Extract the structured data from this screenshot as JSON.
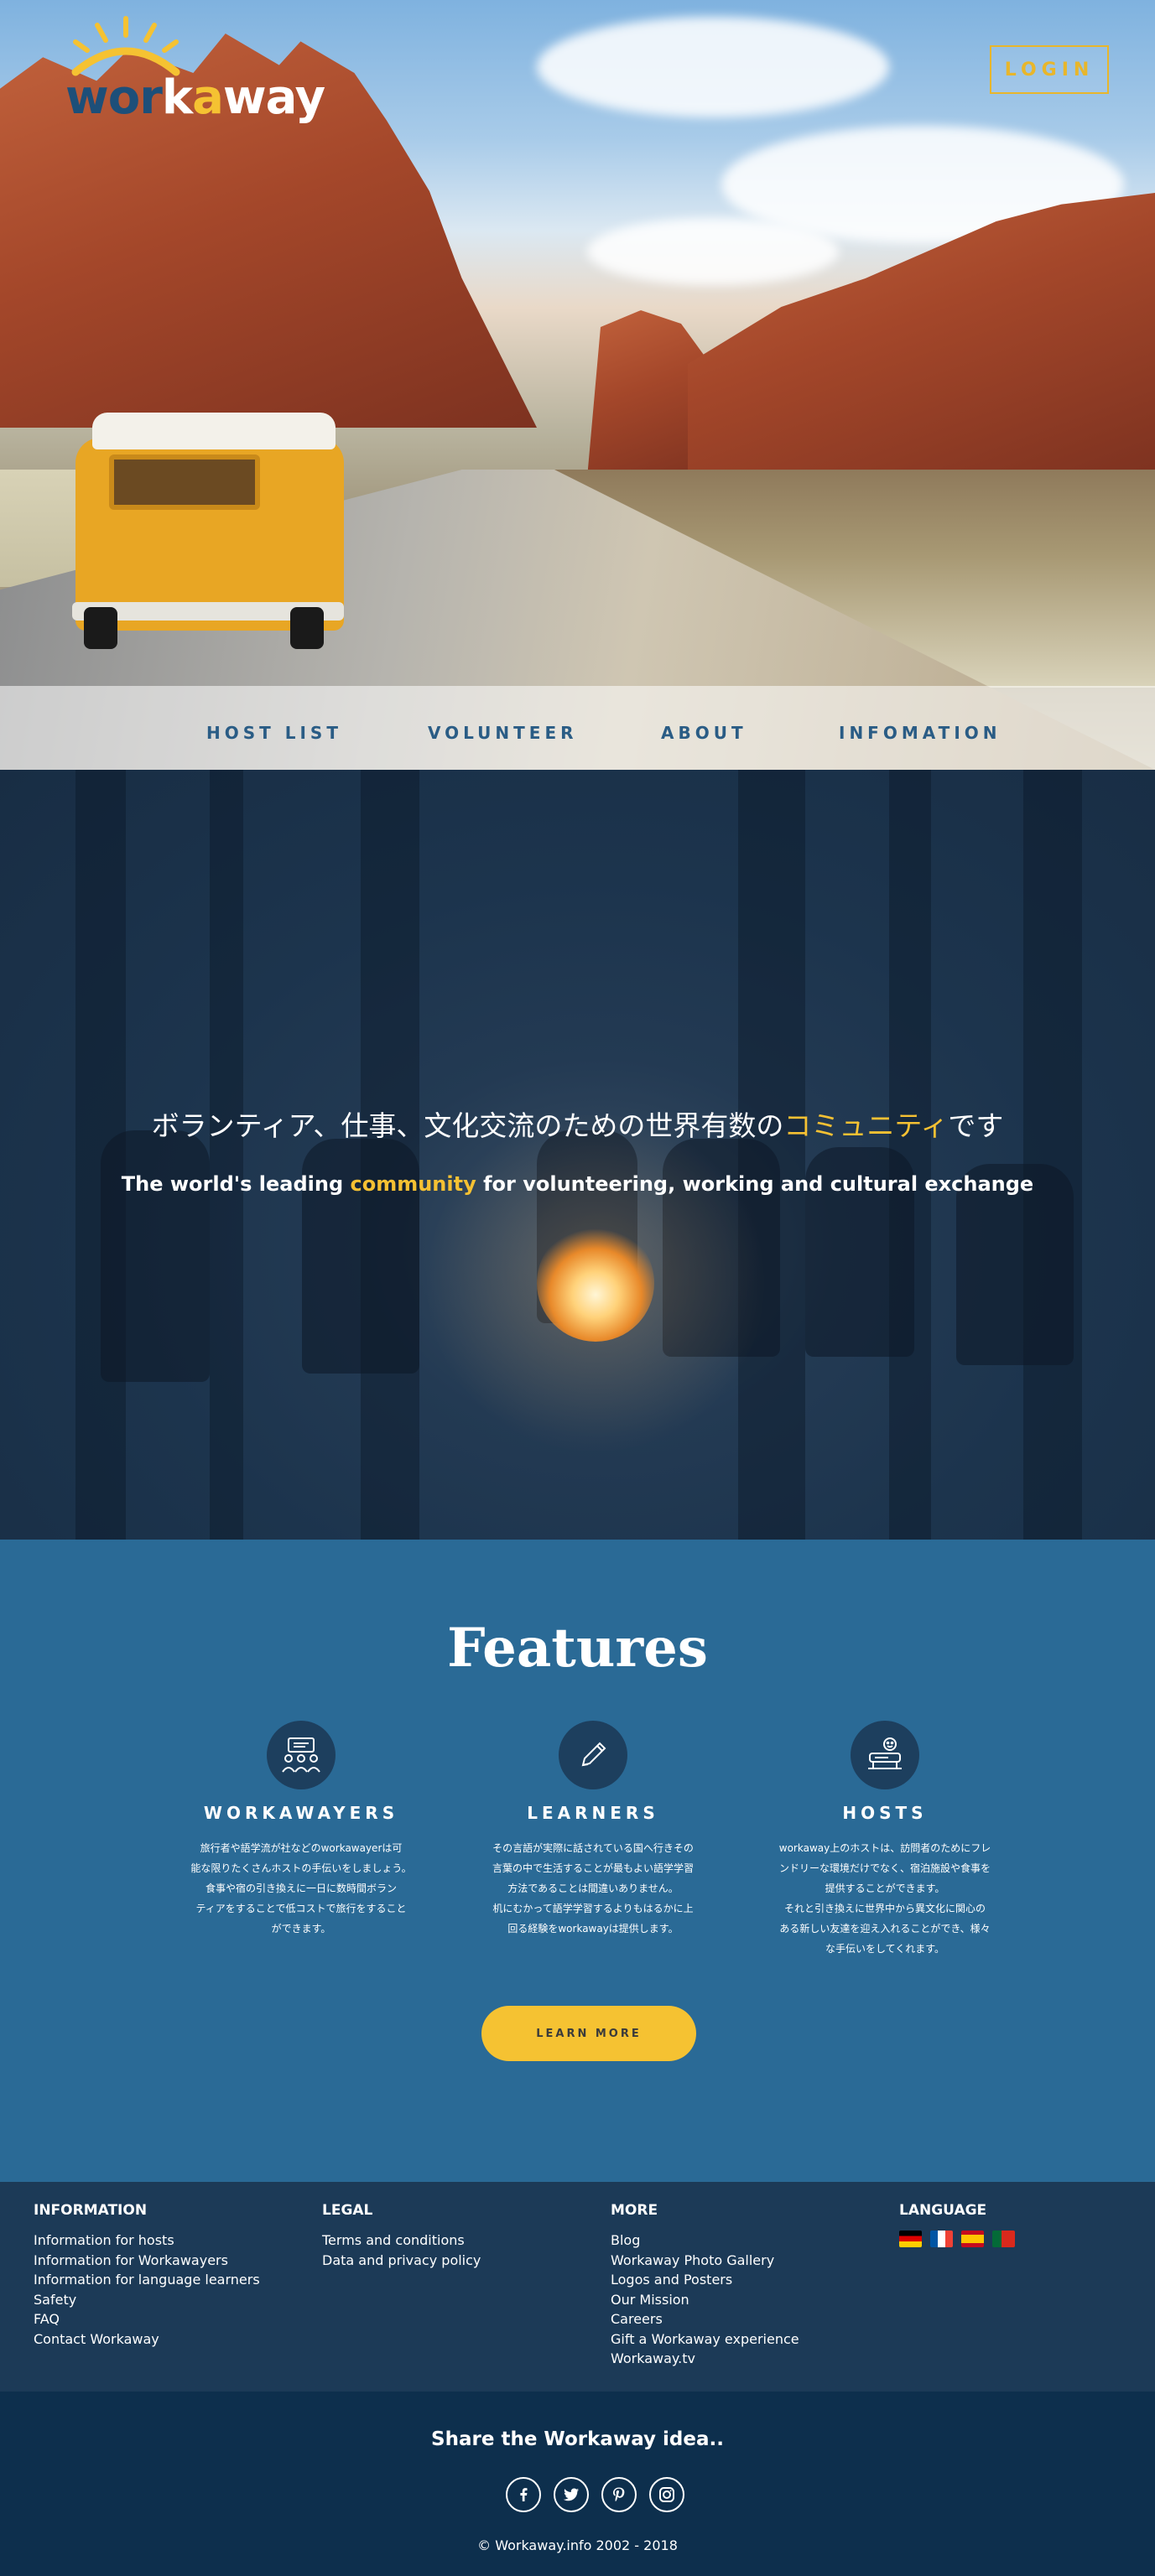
{
  "header": {
    "logo": {
      "part1": "wor",
      "part2": "k",
      "part3": "a",
      "part4": "way",
      "colors": {
        "dark": "#1d4f79",
        "light": "#ffffff",
        "accent": "#f5c232"
      }
    },
    "login_label": "LOGIN"
  },
  "nav": {
    "items": [
      {
        "label": "HOST LIST"
      },
      {
        "label": "VOLUNTEER"
      },
      {
        "label": "ABOUT"
      },
      {
        "label": "INFOMATION"
      }
    ]
  },
  "hero2": {
    "jp_before": "ボランティア、仕事、文化交流のための世界有数の",
    "jp_highlight": "コミュニティ",
    "jp_after": "です",
    "en_before": "The world's leading ",
    "en_highlight": "community",
    "en_after": " for volunteering, working and cultural exchange"
  },
  "features": {
    "title": "Features",
    "items": [
      {
        "icon": "presentation-group-icon",
        "title": "WORKAWAYERS",
        "lines": [
          "旅行者や語学流が社などのworkawayerは可",
          "能な限りたくさんホストの手伝いをしましょう。",
          "食事や宿の引き換えに一日に数時間ボラン",
          "ティアをすることで低コストで旅行をすること",
          "ができます。"
        ]
      },
      {
        "icon": "pencil-icon",
        "title": "LEARNERS",
        "lines": [
          "その言語が実際に話されている国へ行きその",
          "言葉の中で生活することが最もよい語学学習",
          "方法であることは間違いありません。",
          "机にむかって語学学習するよりもはるかに上",
          "回る経験をworkawayは提供します。"
        ]
      },
      {
        "icon": "host-desk-icon",
        "title": "HOSTS",
        "lines": [
          "workaway上のホストは、訪問者のためにフレ",
          "ンドリーな環境だけでなく、宿泊施設や食事を",
          "提供することができます。",
          "それと引き換えに世界中から異文化に関心の",
          "ある新しい友達を迎え入れることができ、様々",
          "な手伝いをしてくれます。"
        ]
      }
    ],
    "learn_more_label": "LEARN MORE"
  },
  "footer": {
    "information": {
      "title": "INFORMATION",
      "links": [
        "Information for hosts",
        "Information for Workawayers",
        "Information for language learners",
        "Safety",
        "FAQ",
        "Contact Workaway"
      ]
    },
    "legal": {
      "title": "LEGAL",
      "links": [
        "Terms and conditions",
        "Data and privacy policy"
      ]
    },
    "more": {
      "title": "MORE",
      "links": [
        "Blog",
        "Workaway Photo Gallery",
        "Logos and Posters",
        "Our Mission",
        "Careers",
        "Gift a Workaway experience",
        "Workaway.tv"
      ]
    },
    "language": {
      "title": "LANGUAGE",
      "flags": [
        "germany-flag-icon",
        "france-flag-icon",
        "spain-flag-icon",
        "portugal-flag-icon"
      ]
    }
  },
  "share": {
    "title": "Share the Workaway idea..",
    "icons": [
      "facebook-icon",
      "twitter-icon",
      "pinterest-icon",
      "instagram-icon"
    ],
    "copyright": "© Workaway.info 2002 - 2018"
  }
}
